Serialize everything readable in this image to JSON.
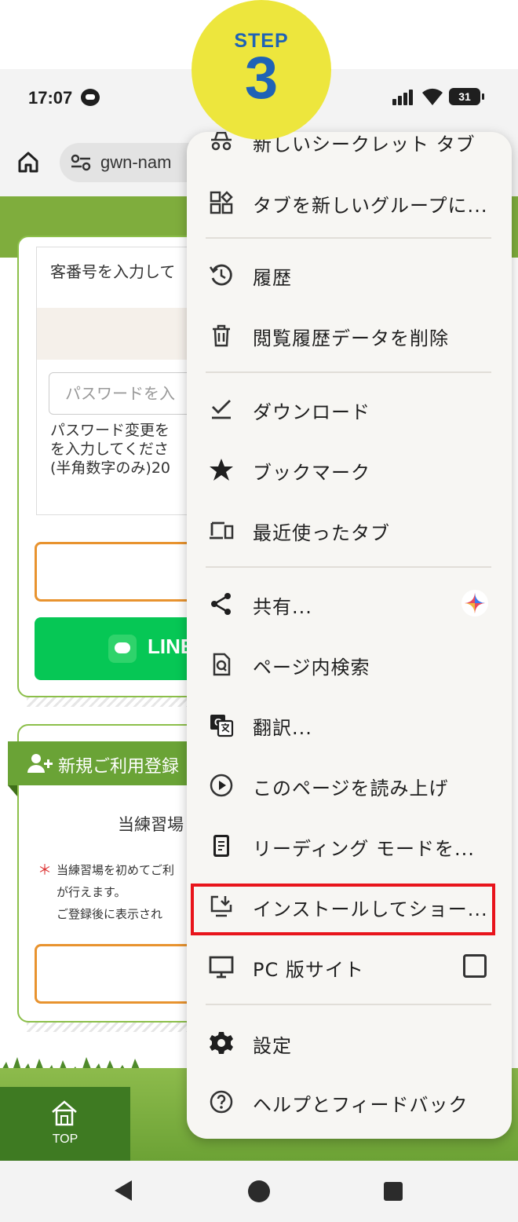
{
  "step": {
    "word": "STEP",
    "number": "3"
  },
  "status_bar": {
    "time": "17:07",
    "battery": "31"
  },
  "browser": {
    "url": "gwn-nam"
  },
  "page": {
    "customer_prompt": "客番号を入力して",
    "password_placeholder": "パスワードを入",
    "password_note": [
      "パスワード変更を",
      "を入力してくださ",
      "(半角数字のみ)20"
    ],
    "line_button": "LINE",
    "register_heading": "新規ご利用登録",
    "practice_text": "当練習場",
    "note_lines": [
      "当練習場を初めてご利",
      "が行えます。",
      "ご登録後に表示され"
    ],
    "note_mark": "＊",
    "nav_top": "TOP"
  },
  "menu": {
    "items": [
      {
        "label": "新しいシークレット タブ",
        "icon": "incognito-icon"
      },
      {
        "label": "タブを新しいグループに...",
        "icon": "tab-group-icon"
      },
      {
        "label": "履歴",
        "icon": "history-icon"
      },
      {
        "label": "閲覧履歴データを削除",
        "icon": "trash-icon"
      },
      {
        "label": "ダウンロード",
        "icon": "download-icon"
      },
      {
        "label": "ブックマーク",
        "icon": "star-icon"
      },
      {
        "label": "最近使ったタブ",
        "icon": "devices-icon"
      },
      {
        "label": "共有...",
        "icon": "share-icon"
      },
      {
        "label": "ページ内検索",
        "icon": "find-in-page-icon"
      },
      {
        "label": "翻訳...",
        "icon": "translate-icon"
      },
      {
        "label": "このページを読み上げ",
        "icon": "play-circle-icon"
      },
      {
        "label": "リーディング モードを...",
        "icon": "reading-mode-icon"
      },
      {
        "label": "インストールしてショー...",
        "icon": "install-app-icon"
      },
      {
        "label": "PC 版サイト",
        "icon": "desktop-icon"
      },
      {
        "label": "設定",
        "icon": "settings-icon"
      },
      {
        "label": "ヘルプとフィードバック",
        "icon": "help-icon"
      }
    ],
    "desktop_site_checked": false
  },
  "colors": {
    "step_badge": "#ede63d",
    "step_text": "#1f63b6",
    "highlight": "#e8141b",
    "line_green": "#06c755",
    "site_green": "#7fad3d"
  }
}
